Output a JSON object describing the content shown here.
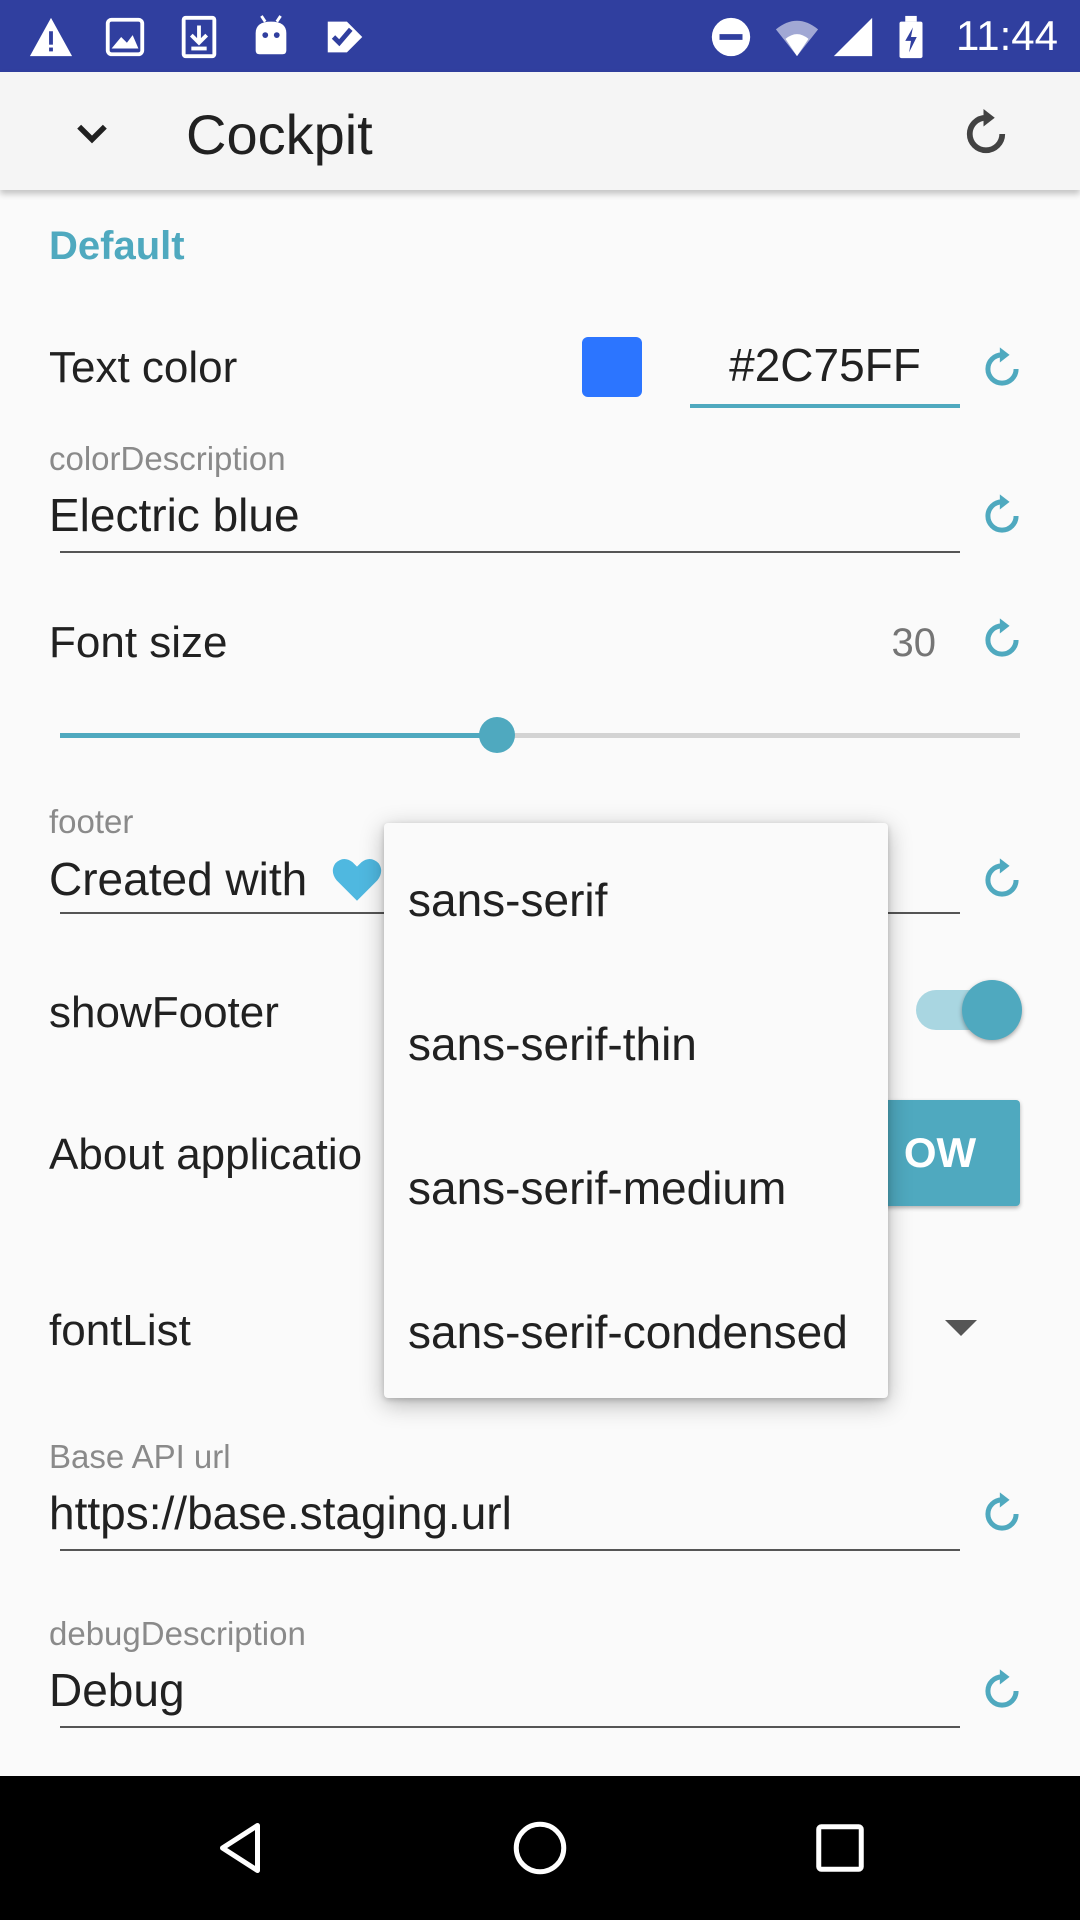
{
  "status_bar": {
    "time": "11:44",
    "left_icons": [
      "warning-icon",
      "image-icon",
      "download-icon",
      "android-icon",
      "checklist-icon"
    ],
    "right_icons": [
      "do-not-disturb-icon",
      "wifi-icon",
      "signal-icon",
      "battery-charging-icon"
    ]
  },
  "toolbar": {
    "title": "Cockpit",
    "collapse_icon": "chevron-down-icon",
    "reset_all_icon": "refresh-icon"
  },
  "section": {
    "title": "Default"
  },
  "text_color": {
    "label": "Text color",
    "swatch_color": "#2C75FF",
    "value": "#2C75FF"
  },
  "color_description": {
    "label": "colorDescription",
    "value": "Electric blue"
  },
  "font_size": {
    "label": "Font size",
    "value": "30",
    "slider_fraction": 0.455
  },
  "footer": {
    "label": "footer",
    "value": "Created with"
  },
  "show_footer": {
    "label": "showFooter",
    "on": true
  },
  "about": {
    "label": "About applicatio",
    "button_label": "OW"
  },
  "font_list": {
    "label": "fontList"
  },
  "base_api": {
    "label": "Base API url",
    "value": "https://base.staging.url"
  },
  "debug_description": {
    "label": "debugDescription",
    "value": "Debug"
  },
  "font_popup": {
    "options": [
      "sans-serif",
      "sans-serif-thin",
      "sans-serif-medium",
      "sans-serif-condensed"
    ]
  },
  "navigation_bar": {
    "buttons": [
      "back-icon",
      "home-icon",
      "recents-icon"
    ]
  },
  "colors": {
    "accent": "#4FA9BF",
    "status_bar": "#303F9F",
    "heart": "#4FB8E0"
  }
}
